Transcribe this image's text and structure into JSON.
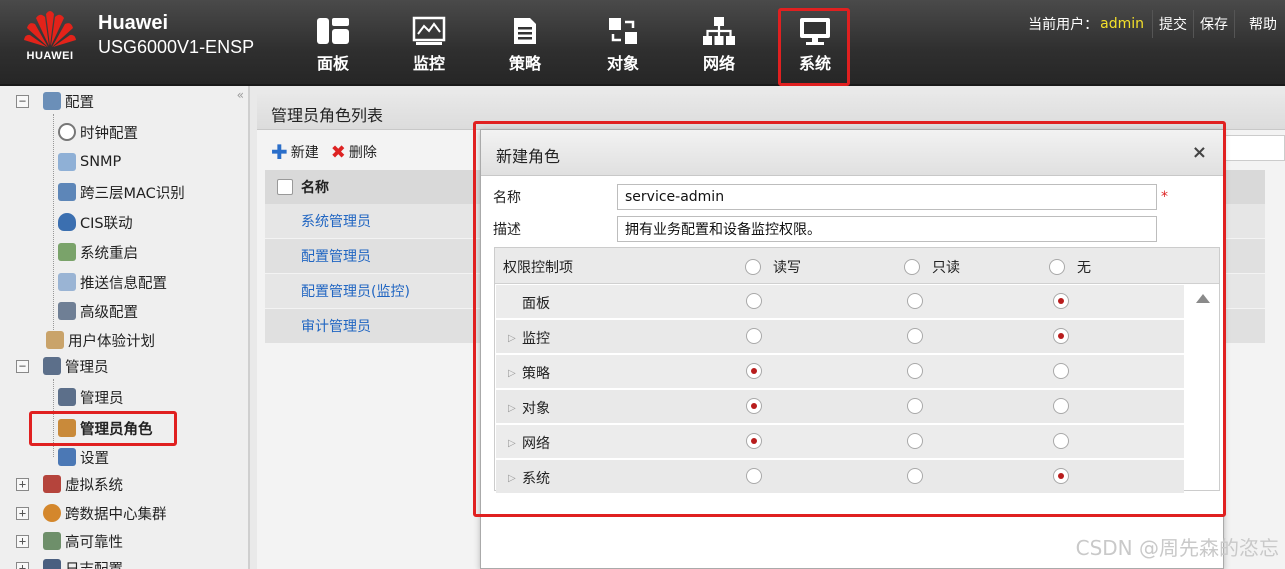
{
  "brand": {
    "logo_text": "HUAWEI",
    "title": "Huawei",
    "model": "USG6000V1-ENSP"
  },
  "nav": [
    {
      "label": "面板",
      "icon": "dashboard-icon"
    },
    {
      "label": "监控",
      "icon": "monitor-icon"
    },
    {
      "label": "策略",
      "icon": "policy-icon"
    },
    {
      "label": "对象",
      "icon": "object-icon"
    },
    {
      "label": "网络",
      "icon": "network-icon"
    },
    {
      "label": "系统",
      "icon": "system-icon",
      "active": true
    }
  ],
  "userbar": {
    "label": "当前用户：",
    "username": "admin",
    "submit": "提交",
    "save": "保存",
    "help": "帮助"
  },
  "sidebar": {
    "config": "配置",
    "items_config": [
      "时钟配置",
      "SNMP",
      "跨三层MAC识别",
      "CIS联动",
      "系统重启",
      "推送信息配置",
      "高级配置"
    ],
    "ux_plan": "用户体验计划",
    "admin": "管理员",
    "items_admin": [
      "管理员",
      "管理员角色",
      "设置"
    ],
    "virtual": "虚拟系统",
    "crossdc": "跨数据中心集群",
    "ha": "高可靠性",
    "log": "日志配置"
  },
  "main": {
    "title": "管理员角色列表",
    "new_label": "新建",
    "delete_label": "删除",
    "col_name": "名称",
    "roles": [
      "系统管理员",
      "配置管理员",
      "配置管理员(监控)",
      "审计管理员"
    ]
  },
  "dialog": {
    "title": "新建角色",
    "name_label": "名称",
    "name_value": "service-admin",
    "required_mark": "*",
    "desc_label": "描述",
    "desc_value": "拥有业务配置和设备监控权限。",
    "perm_header": "权限控制项",
    "col_rw": "读写",
    "col_ro": "只读",
    "col_none": "无",
    "rows": [
      {
        "name": "面板",
        "expandable": false,
        "value": "none"
      },
      {
        "name": "监控",
        "expandable": true,
        "value": "none"
      },
      {
        "name": "策略",
        "expandable": true,
        "value": "rw"
      },
      {
        "name": "对象",
        "expandable": true,
        "value": "rw"
      },
      {
        "name": "网络",
        "expandable": true,
        "value": "rw"
      },
      {
        "name": "系统",
        "expandable": true,
        "value": "none"
      }
    ]
  },
  "watermark": "CSDN @周先森的恣忘",
  "colors": {
    "highlight": "#e02020",
    "link": "#2166c2",
    "username": "#f4e02a",
    "radio_dot": "#b81c1c"
  }
}
